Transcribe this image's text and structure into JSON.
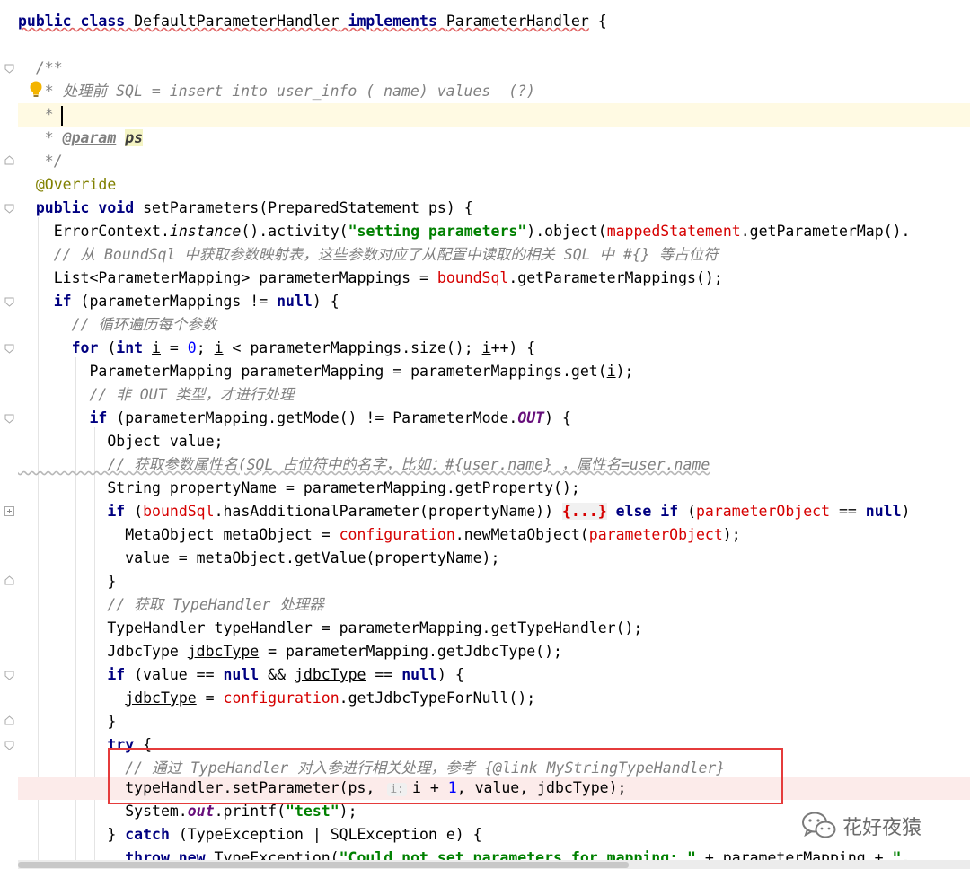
{
  "editor": {
    "language": "java",
    "class_name": "DefaultParameterHandler",
    "interface_name": "ParameterHandler",
    "method_name": "setParameters",
    "code_lines": [
      "public class DefaultParameterHandler implements ParameterHandler {",
      "",
      "/**",
      "* 处理前 SQL = insert into user_info ( name) values (?)",
      "*",
      "* @param ps",
      "*/",
      "@Override",
      "public void setParameters(PreparedStatement ps) {",
      "ErrorContext.instance().activity(\"setting parameters\").object(mappedStatement.getParameterMap().",
      "// 从 BoundSql 中获取参数映射表，这些参数对应了从配置中读取的相关 SQL 中 #{} 等占位符",
      "List<ParameterMapping> parameterMappings = boundSql.getParameterMappings();",
      "if (parameterMappings != null) {",
      "// 循环遍历每个参数",
      "for (int i = 0; i < parameterMappings.size(); i++) {",
      "ParameterMapping parameterMapping = parameterMappings.get(i);",
      "// 非 OUT 类型，才进行处理",
      "if (parameterMapping.getMode() != ParameterMode.OUT) {",
      "Object value;",
      "// 获取参数属性名(SQL 占位符中的名字，比如：#{user.name} ，属性名=user.name",
      "String propertyName = parameterMapping.getProperty();",
      "if (boundSql.hasAdditionalParameter(propertyName)) {...} else if (parameterObject == null)",
      "MetaObject metaObject = configuration.newMetaObject(parameterObject);",
      "value = metaObject.getValue(propertyName);",
      "}",
      "// 获取 TypeHandler 处理器",
      "TypeHandler typeHandler = parameterMapping.getTypeHandler();",
      "JdbcType jdbcType = parameterMapping.getJdbcType();",
      "if (value == null && jdbcType == null) {",
      "jdbcType = configuration.getJdbcTypeForNull();",
      "}",
      "try {",
      "// 通过 TypeHandler 对入参进行相关处理，参考 {@link MyStringTypeHandler}",
      "typeHandler.setParameter(ps, i: i + 1, value, jdbcType);",
      "System.out.printf(\"test\");",
      "} catch (TypeException | SQLException e) {",
      "throw new TypeException(\"Could not set parameters for mapping: \" + parameterMapping + \"."
    ],
    "inlay_hint": "i:",
    "folded_placeholder": "{...}"
  },
  "watermark": {
    "text": "花好夜猿",
    "icon": "wechat-icon"
  },
  "colors": {
    "keyword": "#000080",
    "string": "#008000",
    "field": "#d60000",
    "comment": "#808080",
    "annotation": "#808000",
    "number": "#0000ff",
    "caret_line": "#fffae3",
    "highlight_line": "#fcebea",
    "callout_box": "#e53b3b"
  }
}
